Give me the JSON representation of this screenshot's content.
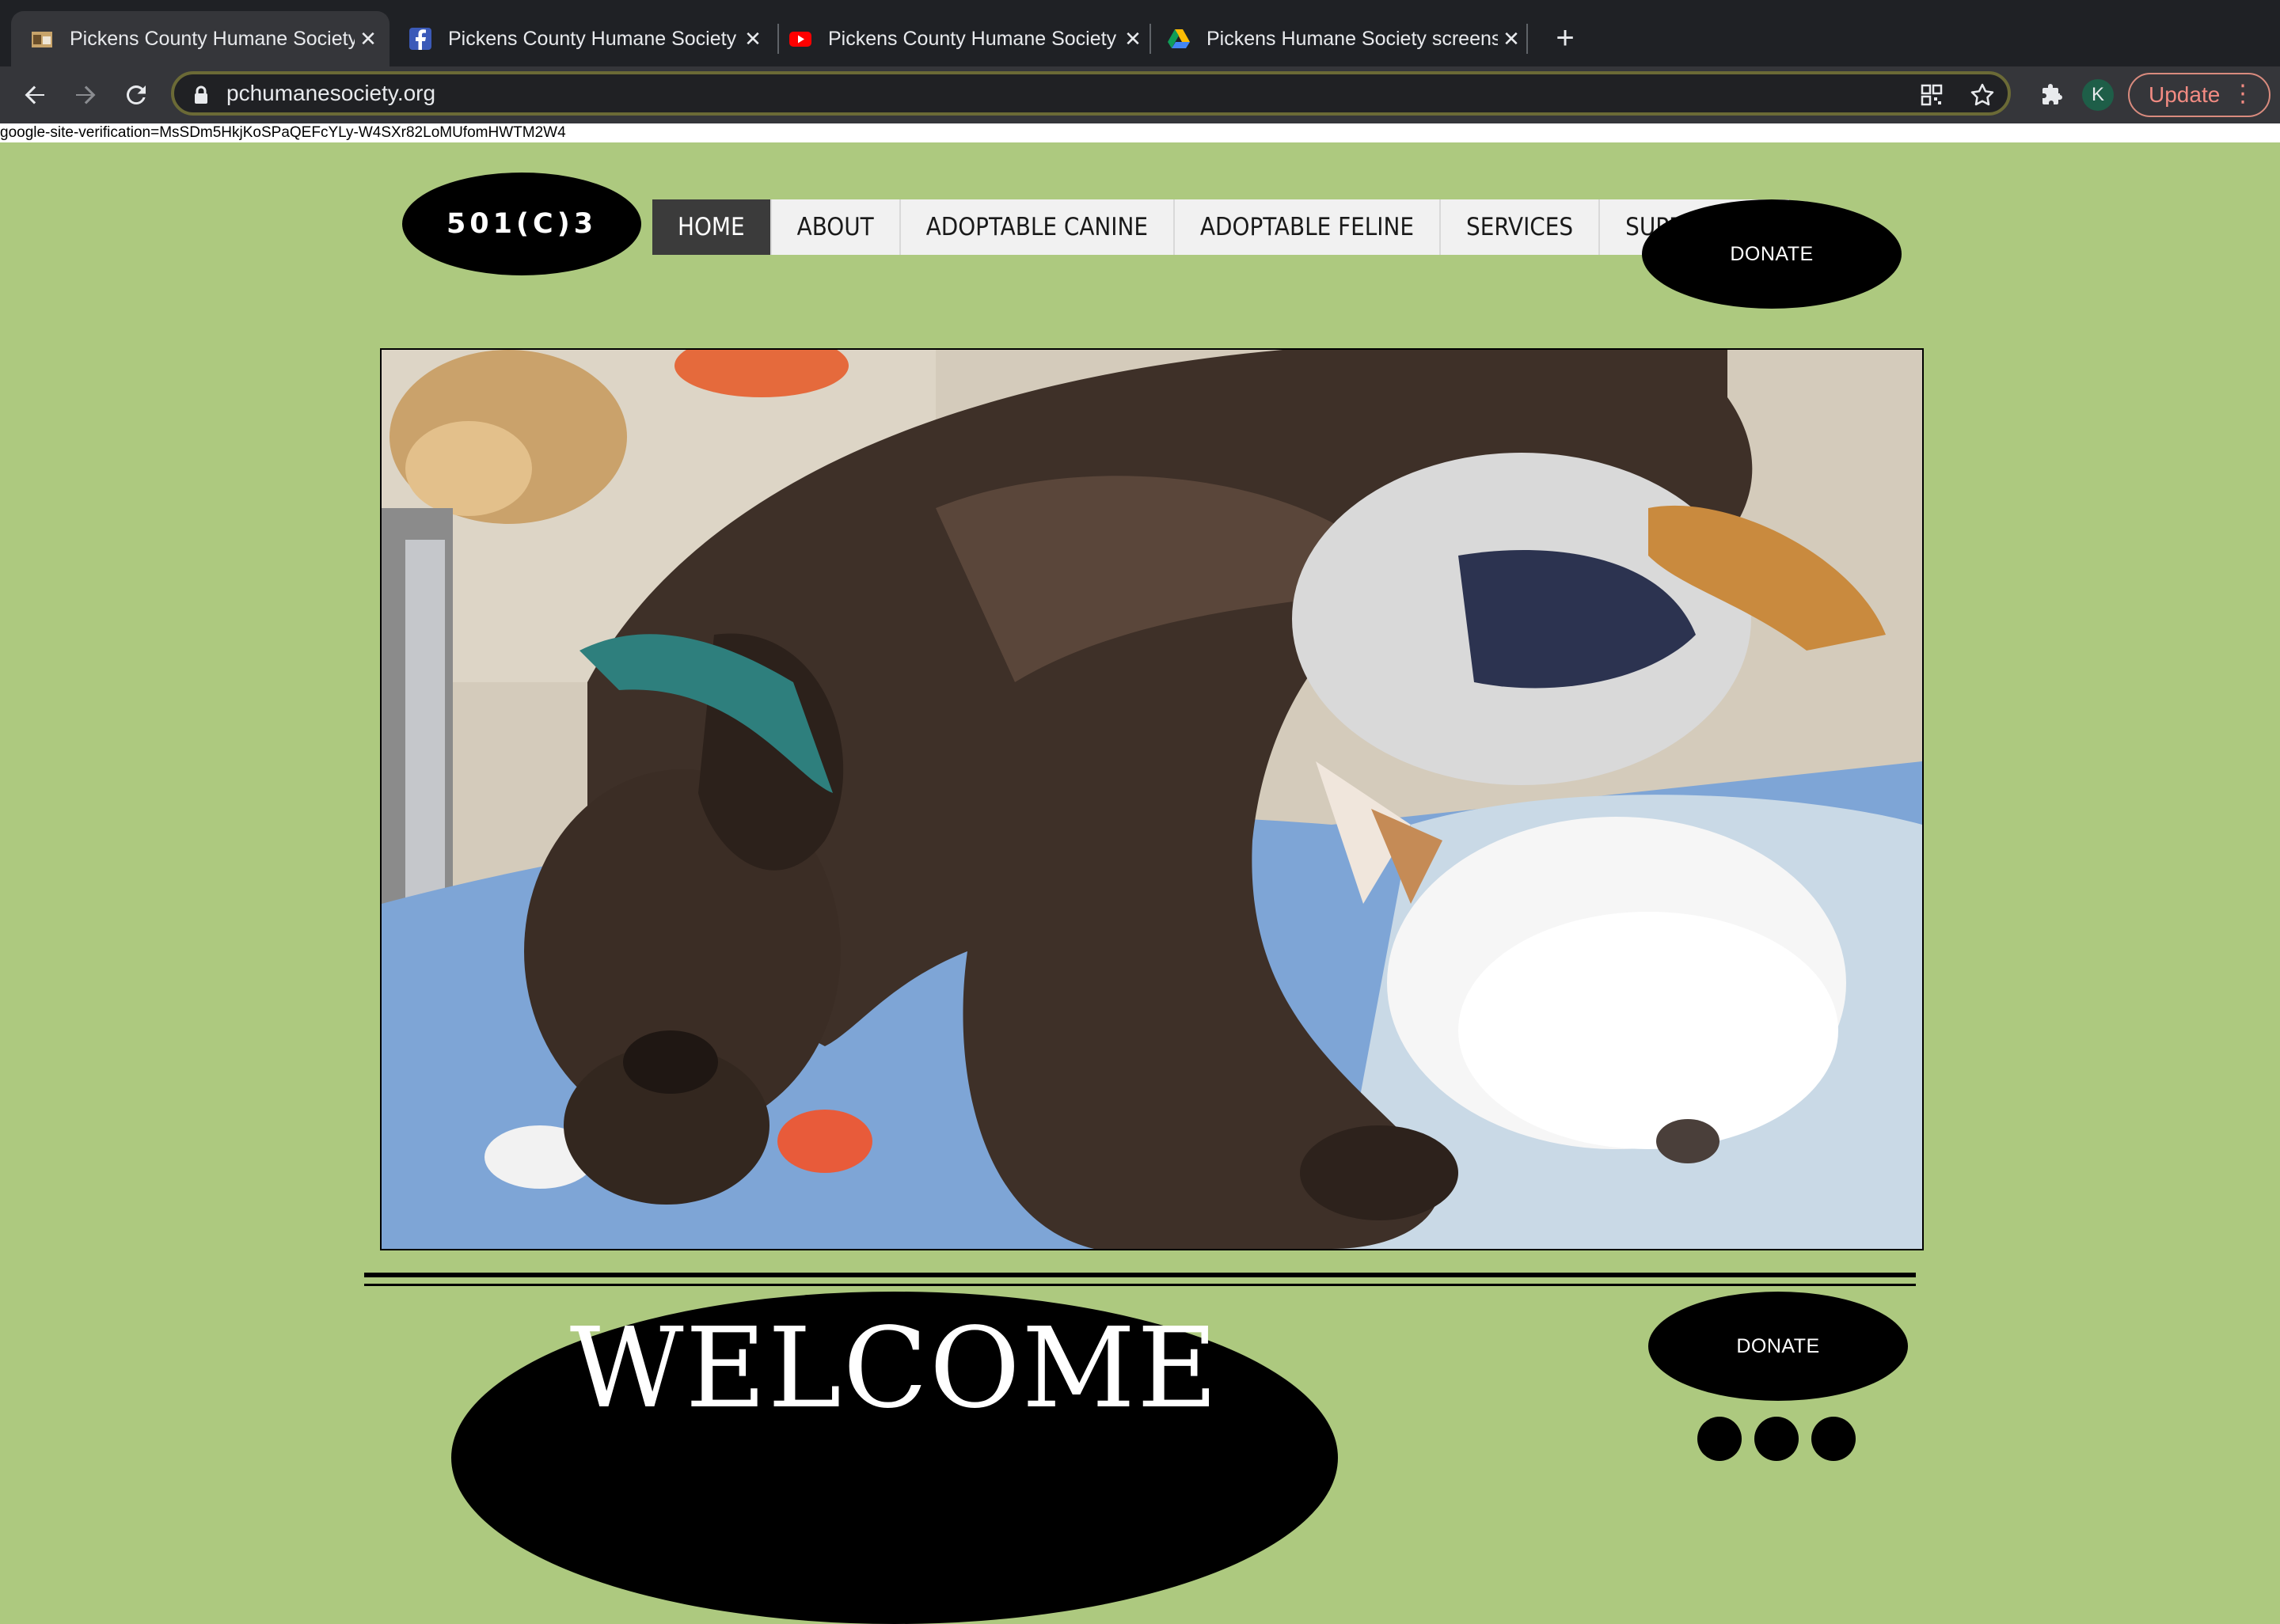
{
  "browser": {
    "tabs": [
      {
        "title": "Pickens County Humane Society",
        "icon": "dog-favicon",
        "active": true
      },
      {
        "title": "Pickens County Humane Society",
        "icon": "facebook-icon",
        "active": false
      },
      {
        "title": "Pickens County Humane Society",
        "icon": "youtube-icon",
        "active": false
      },
      {
        "title": "Pickens Humane Society screenshots",
        "icon": "google-drive-icon",
        "active": false
      }
    ],
    "url": "pchumanesociety.org",
    "profile_initial": "K",
    "update_label": "Update",
    "colors": {
      "update_accent": "#f28b82",
      "omnibox_border": "#6b6a36"
    }
  },
  "page": {
    "verification_text": "google-site-verification=MsSDm5HkjKoSPaQEFcYLy-W4SXr82LoMUfomHWTM2W4",
    "badge_501c3": "501(C)3",
    "nav": {
      "items": [
        "HOME",
        "ABOUT",
        "ADOPTABLE CANINE",
        "ADOPTABLE FELINE",
        "SERVICES",
        "SUPPORT US"
      ],
      "active": "HOME"
    },
    "donate_top": "DONATE",
    "donate_second": "DONATE",
    "welcome": "WELCOME",
    "colors": {
      "background": "#adc97f",
      "button": "#000000",
      "nav_active": "#3b3b3b"
    },
    "hero_image_alt": "Photo of a chocolate dog and a white dog asleep together on blankets"
  }
}
